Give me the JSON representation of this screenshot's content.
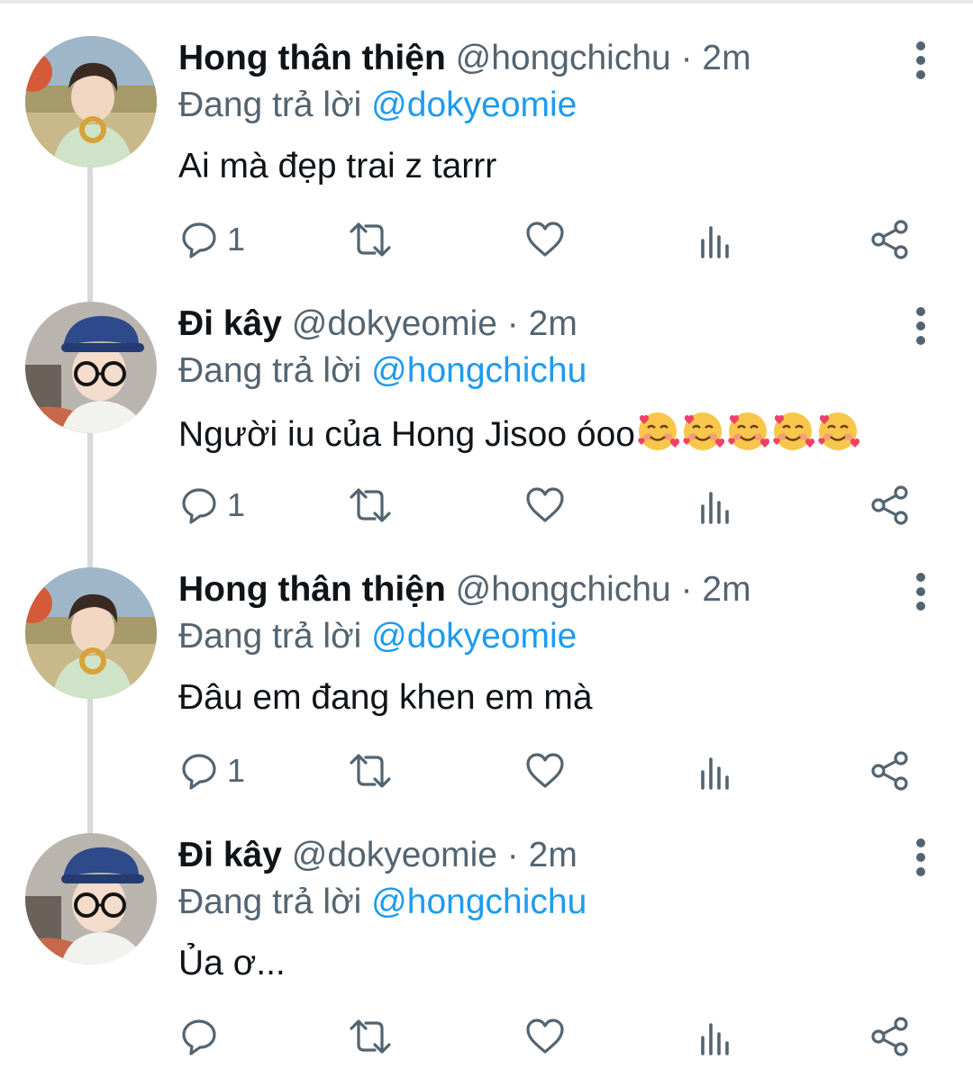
{
  "thread": {
    "tweets": [
      {
        "display_name": "Hong thân thiện",
        "handle": "@hongchichu",
        "separator": "·",
        "time": "2m",
        "reply_prefix": "Đang trả lời",
        "reply_to": "@dokyeomie",
        "text": "Ai mà đẹp trai z tarrr",
        "reply_count": "1",
        "avatar": "hong"
      },
      {
        "display_name": "Đi kây",
        "handle": "@dokyeomie",
        "separator": "·",
        "time": "2m",
        "reply_prefix": "Đang trả lời",
        "reply_to": "@hongchichu",
        "text": "Người iu của Hong Jisoo óoo",
        "emojis": [
          "smiling-face-with-hearts",
          "smiling-face-with-hearts",
          "smiling-face-with-hearts",
          "smiling-face-with-hearts",
          "smiling-face-with-hearts"
        ],
        "reply_count": "1",
        "avatar": "dk"
      },
      {
        "display_name": "Hong thân thiện",
        "handle": "@hongchichu",
        "separator": "·",
        "time": "2m",
        "reply_prefix": "Đang trả lời",
        "reply_to": "@dokyeomie",
        "text": "Đâu em đang khen em mà",
        "reply_count": "1",
        "avatar": "hong"
      },
      {
        "display_name": "Đi kây",
        "handle": "@dokyeomie",
        "separator": "·",
        "time": "2m",
        "reply_prefix": "Đang trả lời",
        "reply_to": "@hongchichu",
        "text": "Ủa ơ...",
        "reply_count": "",
        "avatar": "dk"
      }
    ]
  },
  "icons": {
    "reply": "reply-icon",
    "retweet": "retweet-icon",
    "like": "heart-icon",
    "views": "analytics-icon",
    "share": "share-icon",
    "more": "more-vertical-icon"
  },
  "colors": {
    "text": "#0f1419",
    "secondary": "#536471",
    "link": "#1d9bf0",
    "thread_line": "#d6dadd"
  }
}
